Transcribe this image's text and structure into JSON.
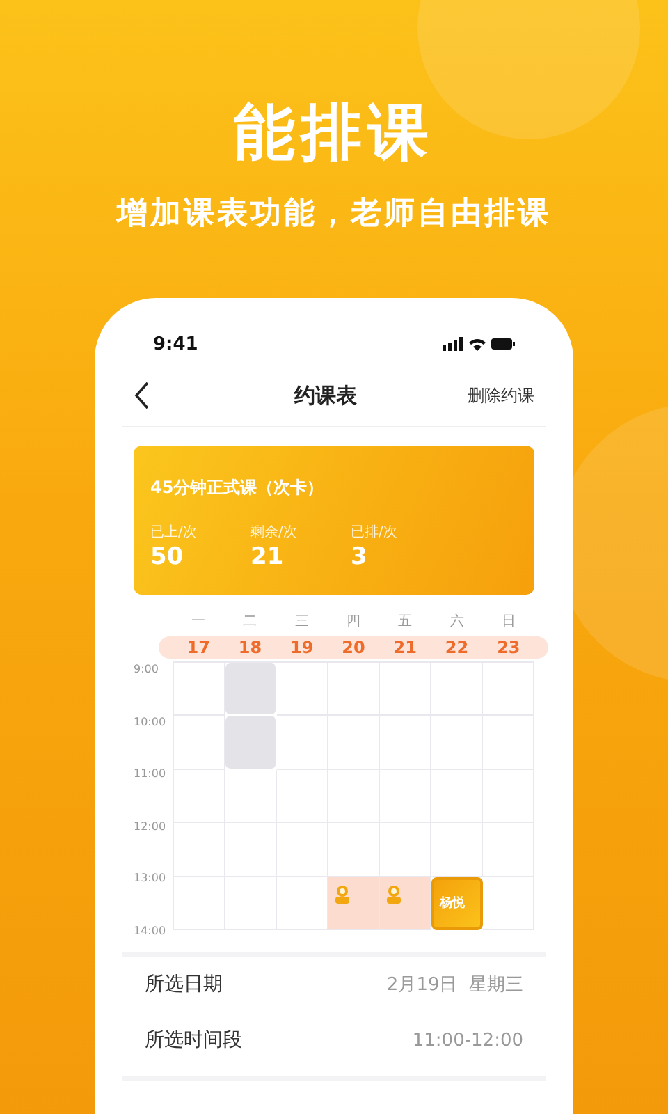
{
  "headline": "能排课",
  "subheadline": "增加课表功能，老师自由排课",
  "status_bar": {
    "time": "9:41"
  },
  "nav": {
    "title": "约课表",
    "action": "删除约课"
  },
  "course_card": {
    "title": "45分钟正式课（次卡）",
    "stats": [
      {
        "label": "已上/次",
        "value": "50"
      },
      {
        "label": "剩余/次",
        "value": "21"
      },
      {
        "label": "已排/次",
        "value": "3"
      }
    ]
  },
  "week": [
    {
      "weekday": "一",
      "date": "17"
    },
    {
      "weekday": "二",
      "date": "18"
    },
    {
      "weekday": "三",
      "date": "19"
    },
    {
      "weekday": "四",
      "date": "20"
    },
    {
      "weekday": "五",
      "date": "21"
    },
    {
      "weekday": "六",
      "date": "22"
    },
    {
      "weekday": "日",
      "date": "23"
    }
  ],
  "times": [
    "9:00",
    "10:00",
    "11:00",
    "12:00",
    "13:00",
    "14:00"
  ],
  "slots": [
    [
      {
        "kind": "empty"
      },
      {
        "kind": "blocked"
      },
      {
        "kind": "empty"
      },
      {
        "kind": "empty"
      },
      {
        "kind": "empty"
      },
      {
        "kind": "empty"
      },
      {
        "kind": "empty"
      }
    ],
    [
      {
        "kind": "empty"
      },
      {
        "kind": "blocked"
      },
      {
        "kind": "empty"
      },
      {
        "kind": "empty"
      },
      {
        "kind": "empty"
      },
      {
        "kind": "empty"
      },
      {
        "kind": "empty"
      }
    ],
    [
      {
        "kind": "empty"
      },
      {
        "kind": "empty"
      },
      {
        "kind": "empty"
      },
      {
        "kind": "empty"
      },
      {
        "kind": "empty"
      },
      {
        "kind": "empty"
      },
      {
        "kind": "empty"
      }
    ],
    [
      {
        "kind": "empty"
      },
      {
        "kind": "empty"
      },
      {
        "kind": "empty"
      },
      {
        "kind": "empty"
      },
      {
        "kind": "empty"
      },
      {
        "kind": "empty"
      },
      {
        "kind": "empty"
      }
    ],
    [
      {
        "kind": "empty"
      },
      {
        "kind": "empty"
      },
      {
        "kind": "empty"
      },
      {
        "kind": "booked"
      },
      {
        "kind": "booked"
      },
      {
        "kind": "mine",
        "name": "杨悦"
      },
      {
        "kind": "empty"
      }
    ]
  ],
  "details": [
    {
      "label": "所选日期",
      "value": "2月19日  星期三"
    },
    {
      "label": "所选时间段",
      "value": "11:00-12:00"
    }
  ]
}
